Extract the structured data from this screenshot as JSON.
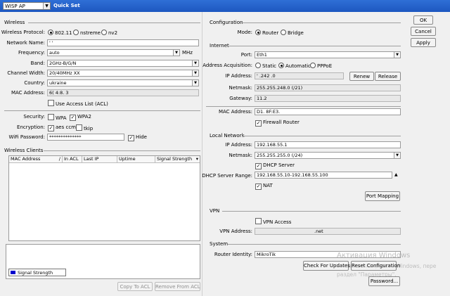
{
  "titlebar": {
    "mode": "WISP AP",
    "title": "Quick Set"
  },
  "buttons_right": {
    "ok": "OK",
    "cancel": "Cancel",
    "apply": "Apply"
  },
  "wireless": {
    "section": "Wireless",
    "protocol_label": "Wireless Protocol:",
    "protocol_options": [
      "802.11",
      "nstreme",
      "nv2"
    ],
    "network_name_label": "Network Name:",
    "network_name": "' '",
    "frequency_label": "Frequency:",
    "frequency": "auto",
    "frequency_unit": "MHz",
    "band_label": "Band:",
    "band": "2GHz-B/G/N",
    "channel_width_label": "Channel Width:",
    "channel_width": "20/40MHz XX",
    "country_label": "Country:",
    "country": "ukraine",
    "mac_label": "MAC Address:",
    "mac": "6(  4:8.  3",
    "acl_label": "Use Access List (ACL)",
    "security_label": "Security:",
    "wpa": "WPA",
    "wpa2": "WPA2",
    "encryption_label": "Encryption:",
    "aes": "aes ccm",
    "tkip": "tkip",
    "wifi_password_label": "WiFi Password:",
    "wifi_password": "**************",
    "hide_label": "Hide"
  },
  "clients": {
    "section": "Wireless Clients",
    "columns": [
      "MAC Address",
      "In ACL",
      "Last IP",
      "Uptime",
      "Signal Strength"
    ],
    "legend": "Signal Strength",
    "copy_btn": "Copy To ACL",
    "remove_btn": "Remove From ACL"
  },
  "configuration": {
    "section": "Configuration",
    "mode_label": "Mode:",
    "mode_options": [
      "Router",
      "Bridge"
    ]
  },
  "internet": {
    "section": "Internet",
    "port_label": "Port:",
    "port": "Eth1",
    "acq_label": "Address Acquisition:",
    "acq_options": [
      "Static",
      "Automatic",
      "PPPoE"
    ],
    "ip_label": "IP Address:",
    "ip": "'   .242  .0",
    "renew": "Renew",
    "release": "Release",
    "netmask_label": "Netmask:",
    "netmask": "255.255.248.0 (/21)",
    "gateway_label": "Gateway:",
    "gateway": "11.2",
    "mac_label": "MAC Address:",
    "mac": "D1.  8F:E3.",
    "firewall_label": "Firewall Router"
  },
  "local": {
    "section": "Local Network",
    "ip_label": "IP Address:",
    "ip": "192.168.55.1",
    "netmask_label": "Netmask:",
    "netmask": "255.255.255.0 (/24)",
    "dhcp_label": "DHCP Server",
    "range_label": "DHCP Server Range:",
    "range": "192.168.55.10-192.168.55.100",
    "nat_label": "NAT",
    "port_mapping": "Port Mapping"
  },
  "vpn": {
    "section": "VPN",
    "access_label": "VPN Access",
    "address_label": "VPN Address:",
    "address": ".net"
  },
  "system": {
    "section": "System",
    "identity_label": "Router Identity:",
    "identity": "MikroTik",
    "check_updates": "Check For Updates",
    "reset": "Reset Configuration",
    "password": "Password..."
  },
  "watermark": {
    "line1": "Активация Windows",
    "line2": "Чтобы активировать Windows, пере",
    "line3": "раздел \"Параметры\"."
  },
  "colors": {
    "titlebar": "#1d57c0",
    "signal_legend": "#0000cc"
  }
}
